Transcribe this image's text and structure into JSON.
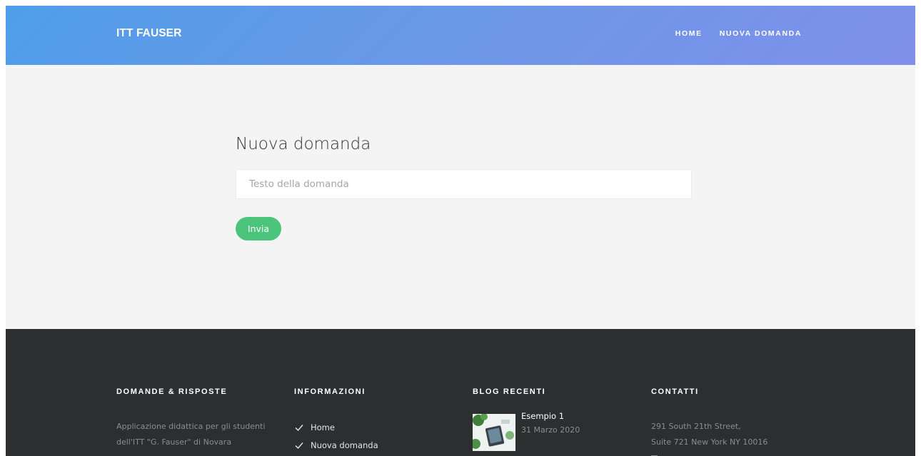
{
  "header": {
    "brand": "ITT FAUSER",
    "nav": [
      {
        "label": "HOME"
      },
      {
        "label": "NUOVA DOMANDA"
      }
    ]
  },
  "main": {
    "title": "Nuova domanda",
    "input": {
      "placeholder": "Testo della domanda",
      "value": ""
    },
    "submit_label": "Invia",
    "submit_color": "#4cc47c"
  },
  "footer": {
    "about": {
      "title": "DOMANDE & RISPOSTE",
      "text": "Applicazione didattica per gli studenti dell'ITT \"G. Fauser\" di Novara"
    },
    "info": {
      "title": "INFORMAZIONI",
      "links": [
        {
          "label": "Home",
          "icon": "check-icon"
        },
        {
          "label": "Nuova domanda",
          "icon": "check-icon"
        }
      ]
    },
    "blog": {
      "title": "BLOG RECENTI",
      "posts": [
        {
          "title": "Esempio 1",
          "date": "31 Marzo 2020",
          "thumb_icon": "blog-thumbnail-image"
        }
      ]
    },
    "contacts": {
      "title": "CONTATTI",
      "address_line1": "291 South 21th Street,",
      "address_line2": "Suite 721 New York NY 10016"
    }
  },
  "colors": {
    "header_gradient_start": "#4f9ee9",
    "header_gradient_end": "#7f90ea",
    "main_bg": "#f4f4f4",
    "footer_bg": "#2d2e30",
    "accent_green": "#4cc47c"
  }
}
